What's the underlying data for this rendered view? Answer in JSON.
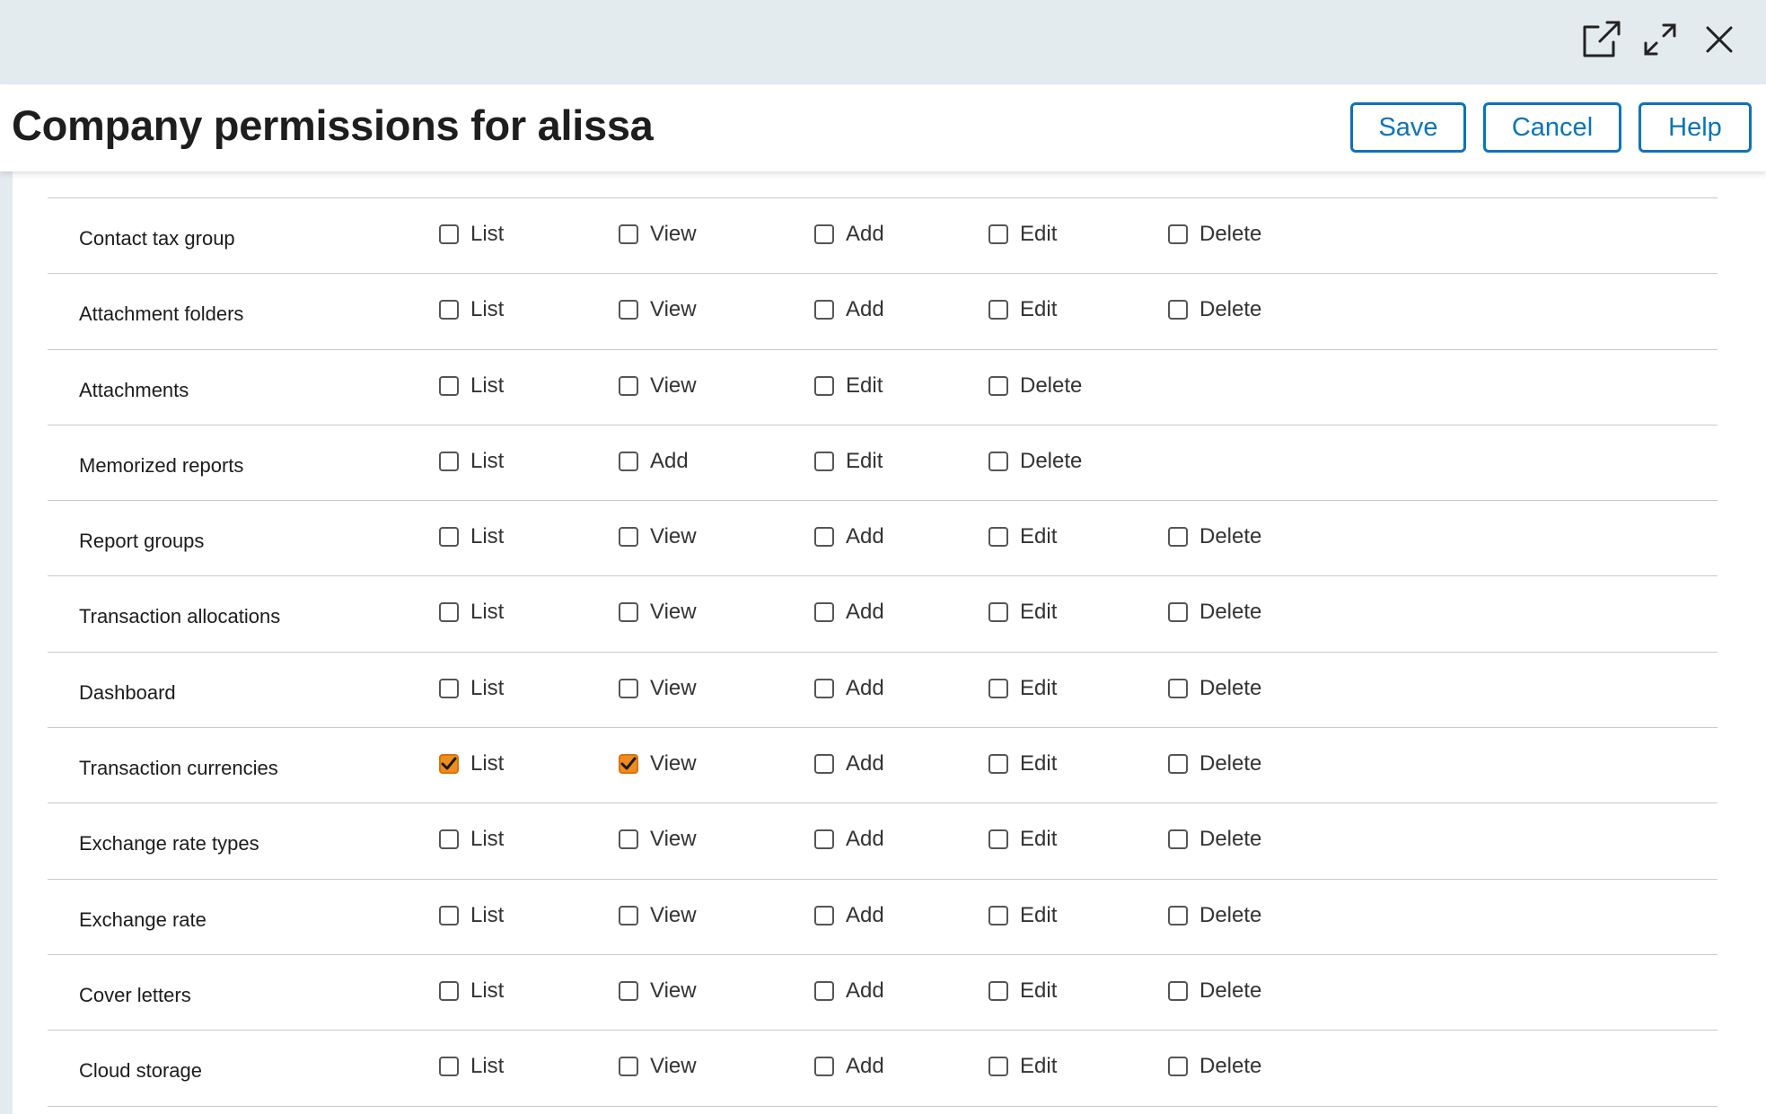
{
  "window": {
    "controls": [
      {
        "name": "open-in-new-window-icon"
      },
      {
        "name": "expand-icon"
      },
      {
        "name": "close-icon"
      }
    ]
  },
  "header": {
    "title": "Company permissions for alissa",
    "buttons": {
      "save": "Save",
      "cancel": "Cancel",
      "help": "Help"
    }
  },
  "colors": {
    "accent": "#0a74b9",
    "checked": "#f08c1e",
    "topbar": "#e4ebee"
  },
  "rows": [
    {
      "label": "Contact tax group",
      "perms": [
        {
          "label": "List",
          "checked": false
        },
        {
          "label": "View",
          "checked": false
        },
        {
          "label": "Add",
          "checked": false
        },
        {
          "label": "Edit",
          "checked": false
        },
        {
          "label": "Delete",
          "checked": false
        }
      ]
    },
    {
      "label": "Attachment folders",
      "perms": [
        {
          "label": "List",
          "checked": false
        },
        {
          "label": "View",
          "checked": false
        },
        {
          "label": "Add",
          "checked": false
        },
        {
          "label": "Edit",
          "checked": false
        },
        {
          "label": "Delete",
          "checked": false
        }
      ]
    },
    {
      "label": "Attachments",
      "perms": [
        {
          "label": "List",
          "checked": false
        },
        {
          "label": "View",
          "checked": false
        },
        {
          "label": "Edit",
          "checked": false
        },
        {
          "label": "Delete",
          "checked": false
        }
      ]
    },
    {
      "label": "Memorized reports",
      "perms": [
        {
          "label": "List",
          "checked": false
        },
        {
          "label": "Add",
          "checked": false
        },
        {
          "label": "Edit",
          "checked": false
        },
        {
          "label": "Delete",
          "checked": false
        }
      ]
    },
    {
      "label": "Report groups",
      "perms": [
        {
          "label": "List",
          "checked": false
        },
        {
          "label": "View",
          "checked": false
        },
        {
          "label": "Add",
          "checked": false
        },
        {
          "label": "Edit",
          "checked": false
        },
        {
          "label": "Delete",
          "checked": false
        }
      ]
    },
    {
      "label": "Transaction allocations",
      "perms": [
        {
          "label": "List",
          "checked": false
        },
        {
          "label": "View",
          "checked": false
        },
        {
          "label": "Add",
          "checked": false
        },
        {
          "label": "Edit",
          "checked": false
        },
        {
          "label": "Delete",
          "checked": false
        }
      ]
    },
    {
      "label": "Dashboard",
      "perms": [
        {
          "label": "List",
          "checked": false
        },
        {
          "label": "View",
          "checked": false
        },
        {
          "label": "Add",
          "checked": false
        },
        {
          "label": "Edit",
          "checked": false
        },
        {
          "label": "Delete",
          "checked": false
        }
      ]
    },
    {
      "label": "Transaction currencies",
      "perms": [
        {
          "label": "List",
          "checked": true
        },
        {
          "label": "View",
          "checked": true
        },
        {
          "label": "Add",
          "checked": false
        },
        {
          "label": "Edit",
          "checked": false
        },
        {
          "label": "Delete",
          "checked": false
        }
      ]
    },
    {
      "label": "Exchange rate types",
      "perms": [
        {
          "label": "List",
          "checked": false
        },
        {
          "label": "View",
          "checked": false
        },
        {
          "label": "Add",
          "checked": false
        },
        {
          "label": "Edit",
          "checked": false
        },
        {
          "label": "Delete",
          "checked": false
        }
      ]
    },
    {
      "label": "Exchange rate",
      "perms": [
        {
          "label": "List",
          "checked": false
        },
        {
          "label": "View",
          "checked": false
        },
        {
          "label": "Add",
          "checked": false
        },
        {
          "label": "Edit",
          "checked": false
        },
        {
          "label": "Delete",
          "checked": false
        }
      ]
    },
    {
      "label": "Cover letters",
      "perms": [
        {
          "label": "List",
          "checked": false
        },
        {
          "label": "View",
          "checked": false
        },
        {
          "label": "Add",
          "checked": false
        },
        {
          "label": "Edit",
          "checked": false
        },
        {
          "label": "Delete",
          "checked": false
        }
      ]
    },
    {
      "label": "Cloud storage",
      "perms": [
        {
          "label": "List",
          "checked": false
        },
        {
          "label": "View",
          "checked": false
        },
        {
          "label": "Add",
          "checked": false
        },
        {
          "label": "Edit",
          "checked": false
        },
        {
          "label": "Delete",
          "checked": false
        }
      ]
    }
  ]
}
